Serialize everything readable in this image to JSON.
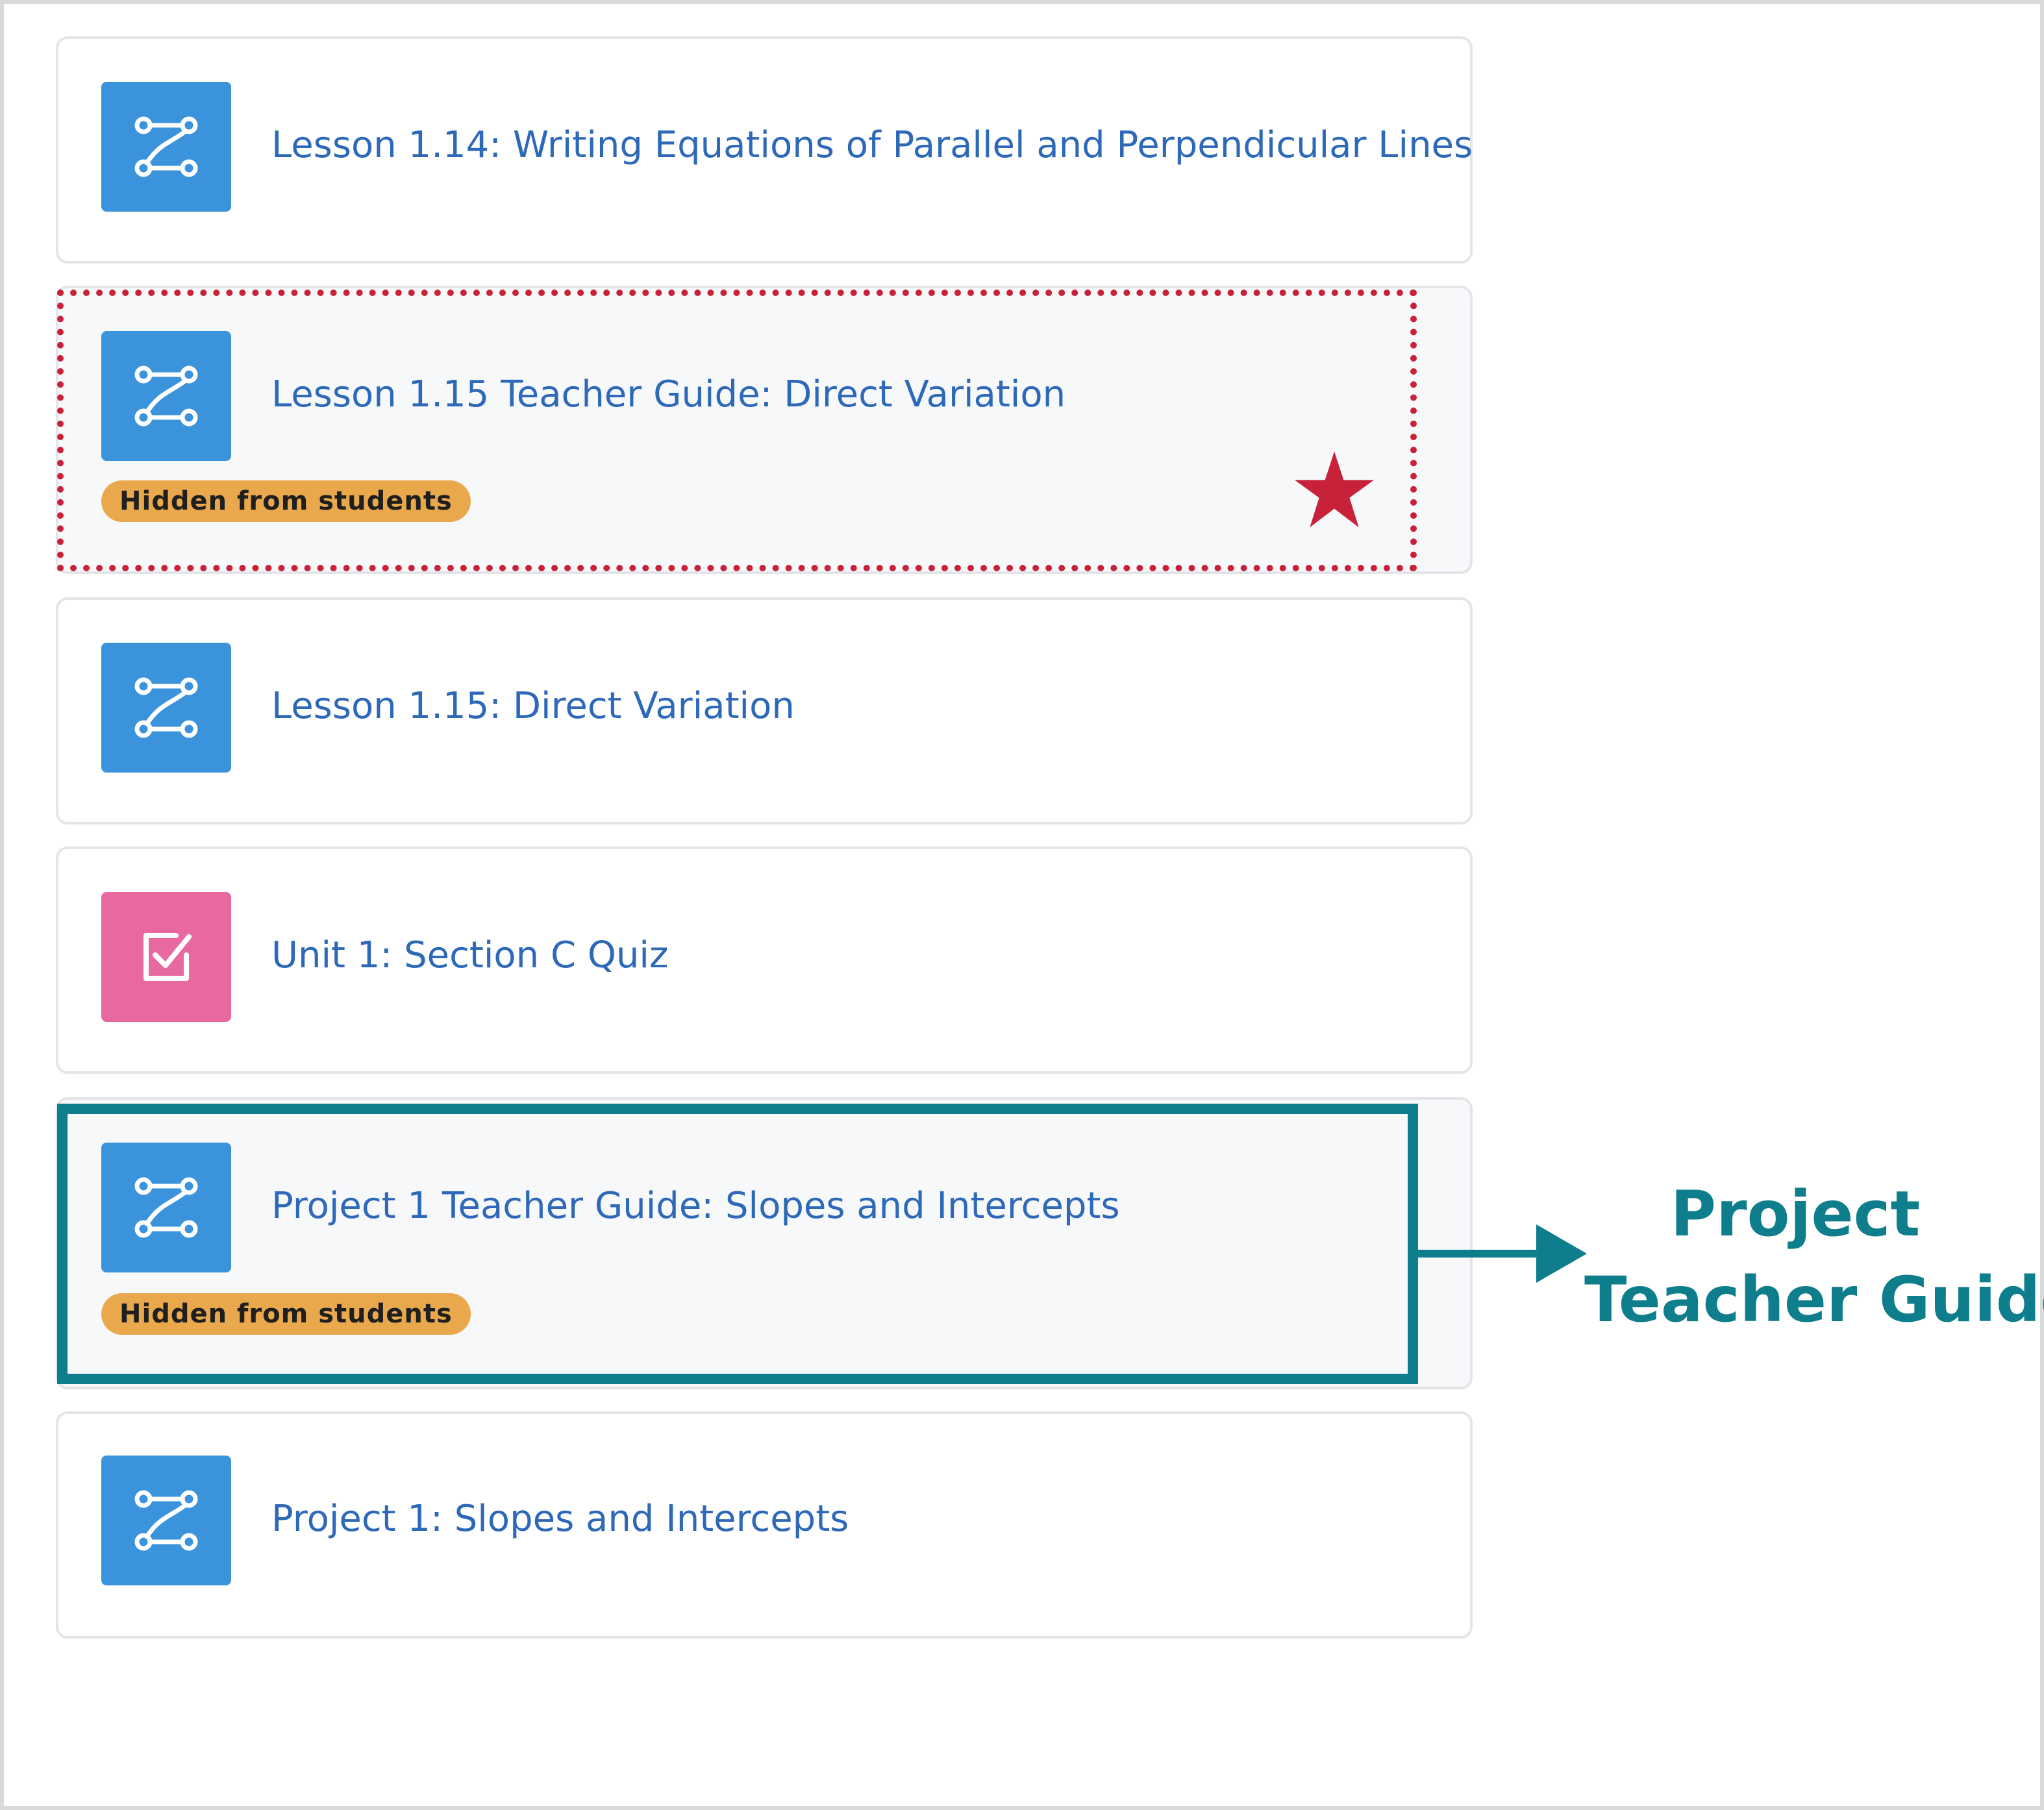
{
  "items": [
    {
      "title": "Lesson 1.14: Writing Equations of Parallel and Perpendicular Lines",
      "icon": "lesson-path-icon",
      "badge": ""
    },
    {
      "title": "Lesson 1.15 Teacher Guide: Direct Variation",
      "icon": "lesson-path-icon",
      "badge": "Hidden from students"
    },
    {
      "title": "Lesson 1.15: Direct Variation",
      "icon": "lesson-path-icon",
      "badge": ""
    },
    {
      "title": "Unit 1: Section C Quiz",
      "icon": "quiz-checkbox-icon",
      "badge": ""
    },
    {
      "title": "Project 1 Teacher Guide: Slopes and Intercepts",
      "icon": "lesson-path-icon",
      "badge": "Hidden from students"
    },
    {
      "title": "Project 1: Slopes and Intercepts",
      "icon": "lesson-path-icon",
      "badge": ""
    }
  ],
  "annotation": {
    "callout_line1": "Project",
    "callout_line2": "Teacher Guide",
    "callout_color": "#0e7d8c",
    "marker_color": "#c8213a",
    "marker_icon": "star-icon",
    "arrow_icon": "arrow-right-icon"
  },
  "colors": {
    "lesson_icon_bg": "#3b93dc",
    "quiz_icon_bg": "#e868a0",
    "link_text": "#2d69b8",
    "badge_bg": "#e9a84c"
  }
}
